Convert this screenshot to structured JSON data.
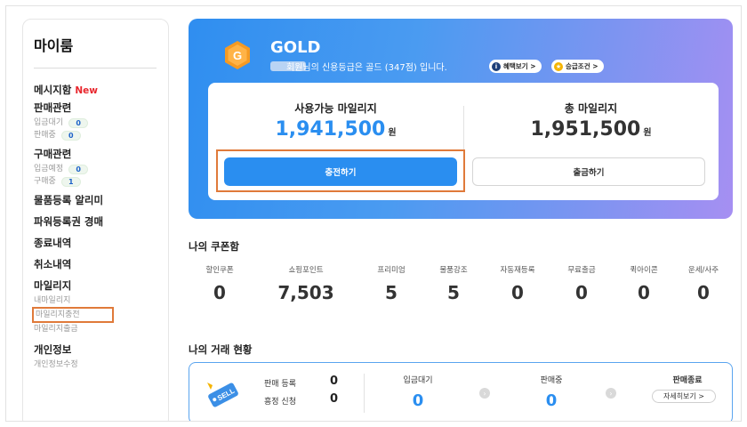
{
  "sidebar": {
    "title": "마이룸",
    "message_box": "메시지함",
    "new_badge": "New",
    "sales": {
      "label": "판매관련",
      "waiting_label": "입금대기",
      "waiting_count": "0",
      "selling_label": "판매중",
      "selling_count": "0"
    },
    "purchase": {
      "label": "구매관련",
      "scheduled_label": "입금예정",
      "scheduled_count": "0",
      "buying_label": "구매중",
      "buying_count": "1"
    },
    "item_alert": "물품등록 알리미",
    "power_auction": "파워등록권 경매",
    "completed": "종료내역",
    "cancelled": "취소내역",
    "mileage": {
      "label": "마일리지",
      "my_mileage": "내마일리지",
      "charge": "마일리지충전",
      "withdraw": "마일리지출금"
    },
    "personal": {
      "label": "개인정보",
      "edit": "개인정보수정"
    }
  },
  "banner": {
    "grade": "GOLD",
    "grade_message": "회원님의 신용등급은 골드 (347점) 입니다.",
    "benefit_button": "혜택보기 >",
    "upgrade_button": "승급조건 >",
    "available_label": "사용가능 마일리지",
    "available_amount": "1,941,500",
    "total_label": "총 마일리지",
    "total_amount": "1,951,500",
    "won": "원",
    "charge_button": "충전하기",
    "withdraw_button": "출금하기"
  },
  "coupons": {
    "title": "나의 쿠폰함",
    "items": [
      {
        "label": "할인쿠폰",
        "value": "0"
      },
      {
        "label": "쇼핑포인트",
        "value": "7,503"
      },
      {
        "label": "프리미엄",
        "value": "5"
      },
      {
        "label": "물품강조",
        "value": "5"
      },
      {
        "label": "자동재등록",
        "value": "0"
      },
      {
        "label": "무료출금",
        "value": "0"
      },
      {
        "label": "퀵아이콘",
        "value": "0"
      },
      {
        "label": "운세/사주",
        "value": "0"
      }
    ]
  },
  "trade": {
    "title": "나의 거래 현황",
    "sell_register_label": "판매 등록",
    "sell_register_count": "0",
    "haggle_label": "흥정 신청",
    "haggle_count": "0",
    "waiting_label": "입금대기",
    "waiting_count": "0",
    "selling_label": "판매중",
    "selling_count": "0",
    "finished_label": "판매종료",
    "detail_button": "자세히보기 >",
    "sell_tag": "SELL"
  },
  "colors": {
    "accent_blue": "#2a8ef0",
    "highlight_orange": "#e07a3a",
    "new_red": "#e8262d",
    "gold": "#f59a23"
  }
}
